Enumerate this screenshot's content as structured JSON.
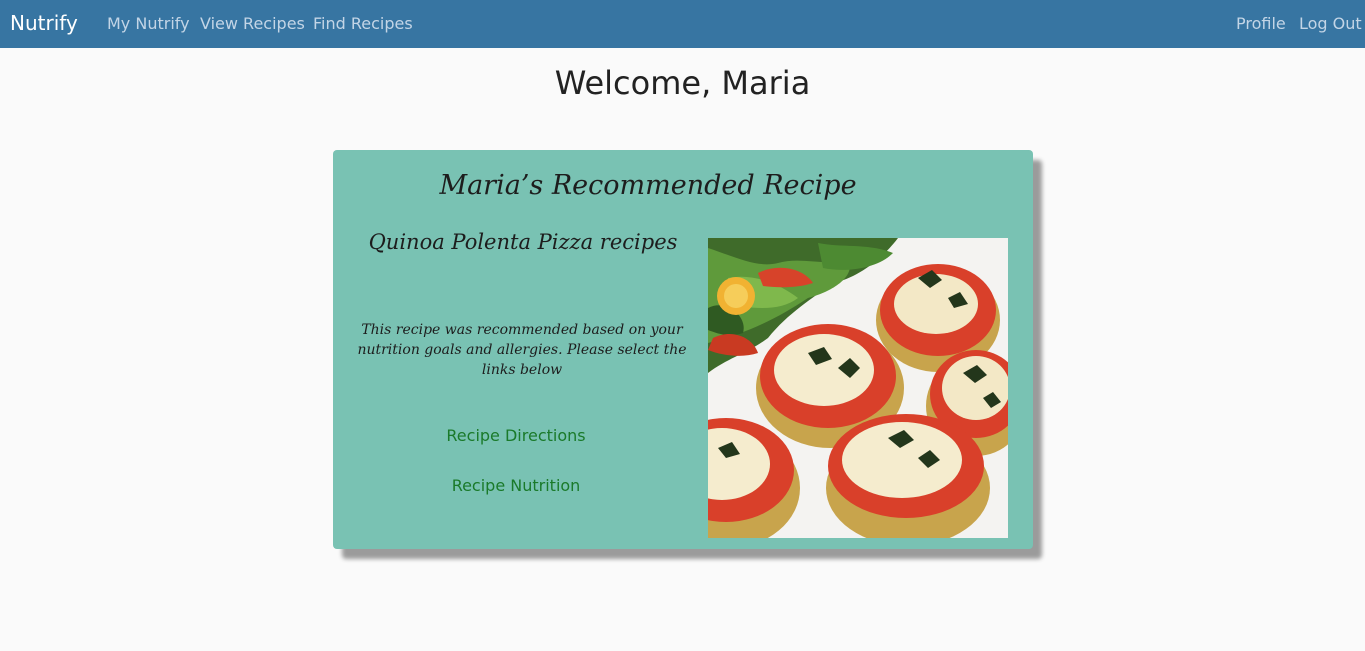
{
  "navbar": {
    "brand": "Nutrify",
    "links": [
      "My Nutrify",
      "View Recipes",
      "Find Recipes"
    ],
    "right_links": [
      "Profile",
      "Log Out"
    ]
  },
  "welcome": "Welcome, Maria",
  "recommendation": {
    "title": "Maria’s Recommended Recipe",
    "recipe_name": "Quinoa Polenta Pizza recipes",
    "description": "This recipe was recommended based on your nutrition goals and allergies. Please select the links below",
    "links": {
      "directions": "Recipe Directions",
      "nutrition": "Recipe Nutrition"
    }
  }
}
